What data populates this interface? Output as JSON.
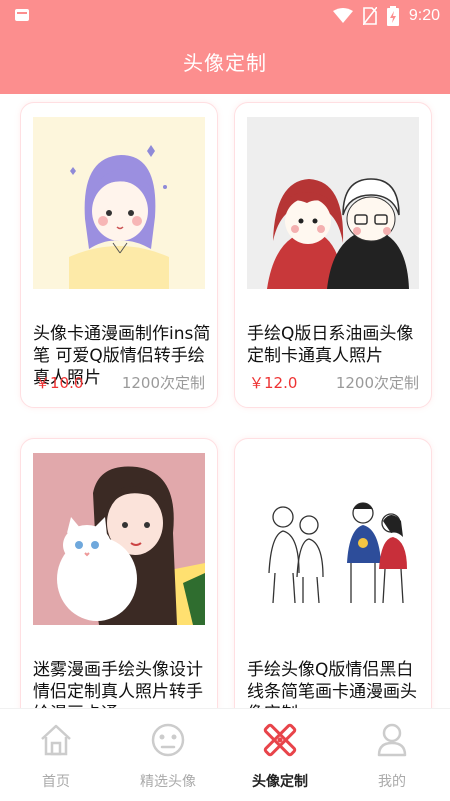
{
  "status_bar": {
    "time": "9:20",
    "icons": [
      "notification-icon",
      "wifi-icon",
      "no-sim-icon",
      "battery-charging-icon"
    ]
  },
  "app_bar": {
    "title": "头像定制"
  },
  "products": [
    {
      "title": "头像卡通漫画制作ins简笔 可爱Q版情侣转手绘真人照片",
      "price": "￥10.0",
      "sold": "1200次定制"
    },
    {
      "title": "手绘Q版日系油画头像定制卡通真人照片",
      "price": "￥12.0",
      "sold": "1200次定制"
    },
    {
      "title": "迷雾漫画手绘头像设计情侣定制真人照片转手绘漫画卡通",
      "price": "",
      "sold": ""
    },
    {
      "title": "手绘头像Q版情侣黑白线条简笔画卡通漫画头像定制",
      "price": "",
      "sold": ""
    }
  ],
  "tab_bar": {
    "tabs": [
      {
        "label": "首页",
        "icon": "home-icon"
      },
      {
        "label": "精选头像",
        "icon": "face-icon"
      },
      {
        "label": "头像定制",
        "icon": "pen-ruler-icon"
      },
      {
        "label": "我的",
        "icon": "person-icon"
      }
    ],
    "active": "头像定制",
    "active_color": "#e8444a",
    "inactive_color": "#cccccc"
  },
  "colors": {
    "accent": "#fc8e8e",
    "price": "#e33333"
  }
}
